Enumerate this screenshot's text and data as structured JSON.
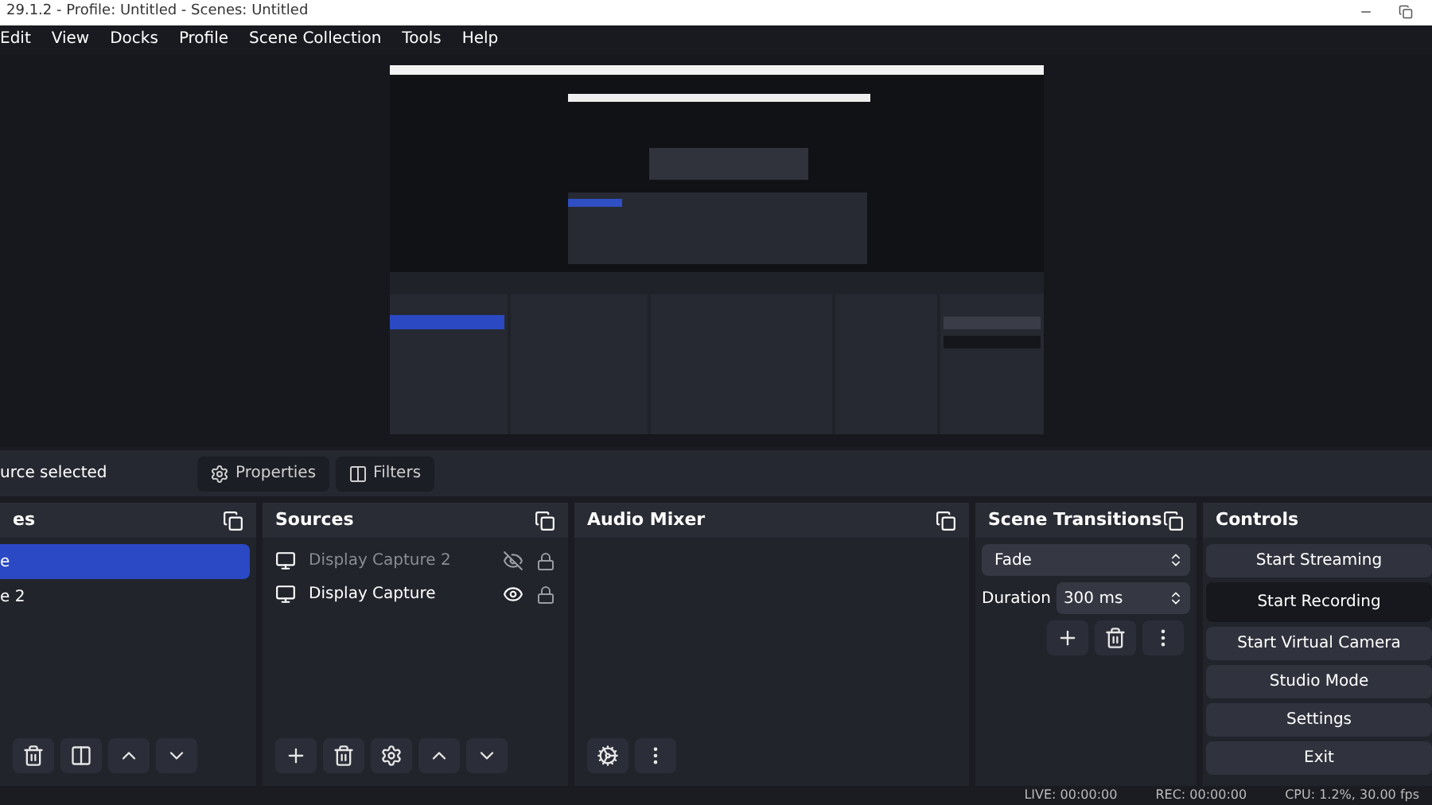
{
  "window": {
    "title": "29.1.2 - Profile: Untitled - Scenes: Untitled"
  },
  "menu": [
    "Edit",
    "View",
    "Docks",
    "Profile",
    "Scene Collection",
    "Tools",
    "Help"
  ],
  "preview": {
    "kind": "picture"
  },
  "context_bar": {
    "label": "urce selected",
    "buttons": [
      {
        "label": "Properties",
        "kind": "gear"
      },
      {
        "label": "Filters",
        "kind": "filter"
      }
    ]
  },
  "scenes": {
    "title": "es",
    "items": [
      {
        "label": "e",
        "selected": true
      },
      {
        "label": "e 2",
        "selected": false
      }
    ],
    "toolbar": [
      {
        "kind": "trash"
      },
      {
        "kind": "filter"
      },
      {
        "kind": "up"
      },
      {
        "kind": "down"
      }
    ]
  },
  "sources": {
    "title": "Sources",
    "items": [
      {
        "label": "Display Capture 2",
        "visible": false
      },
      {
        "label": "Display Capture",
        "visible": true
      }
    ],
    "toolbar": [
      {
        "kind": "plus"
      },
      {
        "kind": "trash"
      },
      {
        "kind": "gear"
      },
      {
        "kind": "up"
      },
      {
        "kind": "down"
      }
    ]
  },
  "audio_mixer": {
    "title": "Audio Mixer",
    "toolbar": [
      {
        "kind": "gears"
      },
      {
        "kind": "dots"
      }
    ]
  },
  "scene_transitions": {
    "title": "Scene Transitions",
    "transition": "Fade",
    "duration_label": "Duration",
    "duration": "300 ms",
    "toolbar": [
      {
        "kind": "plus"
      },
      {
        "kind": "trash"
      },
      {
        "kind": "dots"
      }
    ]
  },
  "controls": {
    "title": "Controls",
    "buttons": [
      {
        "label": "Start Streaming",
        "selected": false
      },
      {
        "label": "Start Recording",
        "selected": true
      },
      {
        "label": "Start Virtual Camera",
        "selected": false
      },
      {
        "label": "Studio Mode",
        "selected": false
      },
      {
        "label": "Settings",
        "selected": false
      },
      {
        "label": "Exit",
        "selected": false
      }
    ]
  },
  "status_bar": [
    "LIVE: 00:00:00",
    "REC: 00:00:00",
    "CPU: 1.2%, 30.00 fps"
  ]
}
